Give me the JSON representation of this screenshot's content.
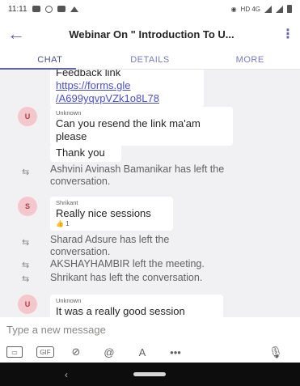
{
  "status_bar": {
    "time": "11:11",
    "network": "HD 4G"
  },
  "header": {
    "back_icon": "arrow-left-icon",
    "title": "Webinar On \" Introduction To U...",
    "more_icon": "vertical-ellipsis-icon"
  },
  "tabs": [
    {
      "label": "CHAT"
    },
    {
      "label": "DETAILS"
    },
    {
      "label": "MORE"
    }
  ],
  "messages": {
    "m0": {
      "partial_text": "Feedback link",
      "link_line1": "https://forms.gle",
      "link_line2": "/A699yqvpVZk1o8L78"
    },
    "m1": {
      "avatar": "U",
      "sender": "Unknown",
      "text_line1": "Can you resend the link ma'am",
      "text_line2": "please"
    },
    "m2": {
      "text": "Thank you"
    },
    "s1": {
      "text_line1": "Ashvini Avinash Bamanikar has left the",
      "text_line2": "conversation."
    },
    "m3": {
      "avatar": "S",
      "sender": "Shrikant",
      "text": "Really nice sessions",
      "reaction_count": "1"
    },
    "s2": {
      "text_line1": "Sharad Adsure has left the",
      "text_line2": "conversation."
    },
    "s3": {
      "text": "AKSHAYHAMBIR left the meeting."
    },
    "s4": {
      "text": "Shrikant has left the conversation."
    },
    "m4": {
      "avatar": "U",
      "sender": "Unknown",
      "text": "It was a really good session"
    }
  },
  "compose": {
    "placeholder": "Type a new message"
  },
  "toolbar": {
    "gif_label": "GIF",
    "more": "•••"
  },
  "colors": {
    "accent": "#6264a7",
    "link": "#4b4fc4",
    "avatar_bg": "#f4c7cd",
    "avatar_text": "#b53b4e",
    "chat_bg": "#f1f1f4"
  }
}
